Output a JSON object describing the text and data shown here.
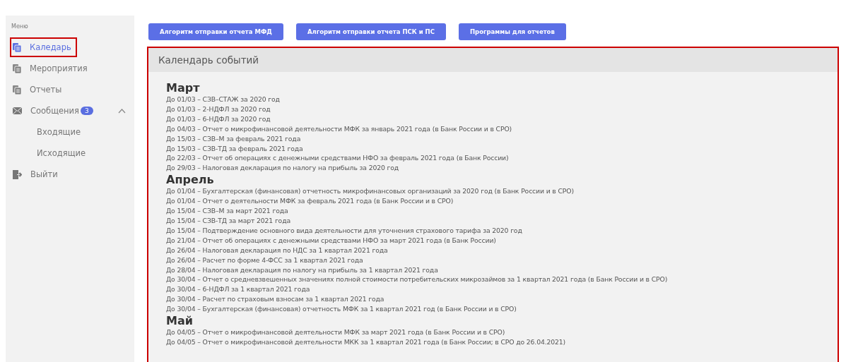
{
  "sidebar": {
    "title": "Меню",
    "items": [
      {
        "label": "Каледарь",
        "kind": "document",
        "selected": true
      },
      {
        "label": "Мероприятия",
        "kind": "document",
        "selected": false
      },
      {
        "label": "Отчеты",
        "kind": "document",
        "selected": false
      },
      {
        "label": "Сообщения",
        "kind": "mail",
        "selected": false,
        "badge": "3",
        "expanded": true,
        "children": [
          {
            "label": "Входящие",
            "selected": false
          },
          {
            "label": "Исходящие",
            "selected": false
          }
        ]
      },
      {
        "label": "Выйти",
        "kind": "logout",
        "selected": false
      }
    ]
  },
  "buttons": [
    "Алгоритм отправки отчета МФД",
    "Алгоритм отправки отчета ПСК и ПС",
    "Программы для отчетов"
  ],
  "calendar": {
    "title": "Календарь событий",
    "months": [
      {
        "name": "Март",
        "events": [
          "До 01/03 – СЗВ–СТАЖ за 2020 год",
          "До 01/03 – 2-НДФЛ за 2020 год",
          "До 01/03 – 6-НДФЛ за 2020 год",
          "До 04/03 – Отчет о микрофинансовой деятельности МФК за январь 2021 года (в Банк России и в СРО)",
          "До 15/03 – СЗВ–М за февраль 2021 года",
          "До 15/03 – СЗВ-ТД за февраль 2021 года",
          "До 22/03 – Отчет об операциях с денежными средствами НФО за февраль 2021 года (в Банк России)",
          "До 29/03 – Налоговая декларация по налогу на прибыль за 2020 год"
        ]
      },
      {
        "name": "Апрель",
        "events": [
          "До 01/04 – Бухгалтерская (финансовая) отчетность микрофинансовых организаций за 2020 год (в Банк России и в СРО)",
          "До 01/04 – Отчет о деятельности МФК за февраль 2021 года (в Банк России и в СРО)",
          "До 15/04 – СЗВ–М за март 2021 года",
          "До 15/04 – СЗВ-ТД за март 2021 года",
          "До 15/04 – Подтверждение основного вида деятельности для уточнения страхового тарифа за 2020 год",
          "До 21/04 – Отчет об операциях с денежными средствами НФО за март 2021 года (в Банк России)",
          "До 26/04 – Налоговая декларация по НДС за 1 квартал 2021 года",
          "До 26/04 – Расчет по форме 4-ФСС за 1 квартал 2021 года",
          "До 28/04 – Налоговая декларация по налогу на прибыль за 1 квартал 2021 года",
          "До 30/04 – Отчет о средневзвешенных значениях полной стоимости потребительских микрозаймов за 1 квартал 2021 года (в Банк России и в СРО)",
          "До 30/04 – 6-НДФЛ за 1 квартал 2021 года",
          "До 30/04 – Расчет по страховым взносам за 1 квартал 2021 года",
          "До 30/04 – Бухгалтерская (финансовая) отчетность МФК за 1 квартал 2021 год (в Банк России и в СРО)"
        ]
      },
      {
        "name": "Май",
        "events": [
          "До 04/05 – Отчет о микрофинансовой деятельности МФК за март 2021 года (в Банк России и в СРО)",
          "До 04/05 – Отчет о микрофинансовой деятельности МКК за 1 квартал 2021 года (в Банк России; в СРО до 26.04.2021)"
        ]
      }
    ]
  }
}
